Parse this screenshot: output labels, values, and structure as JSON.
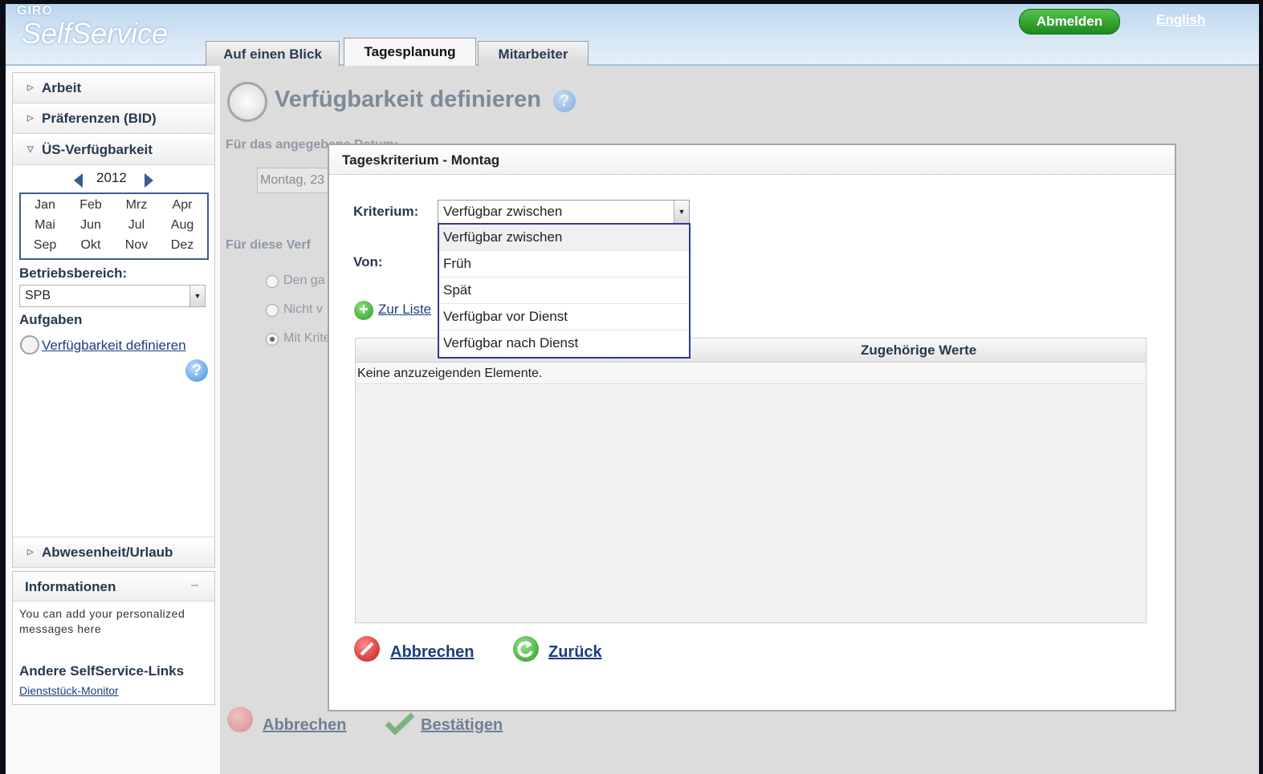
{
  "header": {
    "logo_small": "GIRO",
    "logo_big": "SelfService",
    "logout_label": "Abmelden",
    "language_link": "English",
    "tabs": [
      {
        "label": "Auf einen Blick"
      },
      {
        "label": "Tagesplanung"
      },
      {
        "label": "Mitarbeiter"
      }
    ]
  },
  "sidebar": {
    "accordion": [
      {
        "label": "Arbeit"
      },
      {
        "label": "Präferenzen (BID)"
      },
      {
        "label": "ÜS-Verfügbarkeit"
      }
    ],
    "year": "2012",
    "months": [
      "Jan",
      "Feb",
      "Mrz",
      "Apr",
      "Mai",
      "Jun",
      "Jul",
      "Aug",
      "Sep",
      "Okt",
      "Nov",
      "Dez"
    ],
    "area_label": "Betriebsbereich:",
    "area_value": "SPB",
    "tasks_label": "Aufgaben",
    "task_link": "Verfügbarkeit definieren",
    "absence_label": "Abwesenheit/Urlaub",
    "info": {
      "title": "Informationen",
      "collapse": "–",
      "text": "You can add your personalized messages here",
      "links_title": "Andere SelfService-Links",
      "link": "Dienststück-Monitor"
    }
  },
  "main": {
    "page_title": "Verfügbarkeit definieren",
    "date_label": "Für das angegebene Datum:",
    "date_value": "Montag, 23",
    "section_label": "Für diese Verf",
    "radios": [
      {
        "label": "Den ga",
        "checked": false
      },
      {
        "label": "Nicht v",
        "checked": false
      },
      {
        "label": "Mit Krite",
        "checked": true
      }
    ],
    "cancel_label": "Abbrechen",
    "confirm_label": "Bestätigen"
  },
  "dialog": {
    "title": "Tageskriterium - Montag",
    "criterion_label": "Kriterium:",
    "criterion_value": "Verfügbar zwischen",
    "from_label": "Von:",
    "add_link": "Zur Liste",
    "options": [
      "Verfügbar zwischen",
      "Früh",
      "Spät",
      "Verfügbar vor Dienst",
      "Verfügbar nach Dienst"
    ],
    "grid_header": "Zugehörige Werte",
    "empty_text": "Keine anzuzeigenden Elemente.",
    "cancel_label": "Abbrechen",
    "back_label": "Zurück"
  },
  "colors": {
    "header_bg": "#c9def1",
    "accent_green": "#2ea12f",
    "link_blue": "#1c3d80",
    "dropdown_border": "#2d3b8f"
  }
}
